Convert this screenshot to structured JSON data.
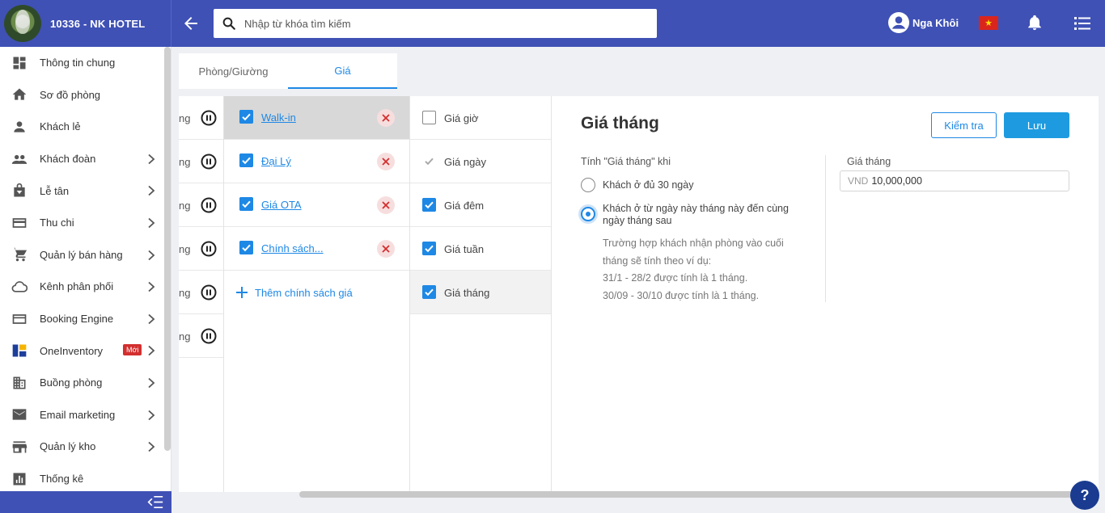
{
  "header": {
    "hotel_name": "10336 - NK HOTEL",
    "search_placeholder": "Nhập từ khóa tìm kiếm",
    "user_name": "Nga Khôi",
    "flag_star": "★"
  },
  "sidebar": {
    "items": [
      {
        "label": "Thông tin chung",
        "icon": "dashboard-icon"
      },
      {
        "label": "Sơ đồ phòng",
        "icon": "home-icon"
      },
      {
        "label": "Khách lẻ",
        "icon": "person-icon"
      },
      {
        "label": "Khách đoàn",
        "icon": "group-icon"
      },
      {
        "label": "Lễ tân",
        "icon": "bag-icon"
      },
      {
        "label": "Thu chi",
        "icon": "card-icon"
      },
      {
        "label": "Quản lý bán hàng",
        "icon": "cart-icon"
      },
      {
        "label": "Kênh phân phối",
        "icon": "cloud-icon"
      },
      {
        "label": "Booking Engine",
        "icon": "booking-icon"
      },
      {
        "label": "OneInventory",
        "icon": "inventory-icon"
      },
      {
        "label": "Buồng phòng",
        "icon": "building-icon"
      },
      {
        "label": "Email marketing",
        "icon": "email-icon"
      },
      {
        "label": "Quản lý kho",
        "icon": "store-icon"
      },
      {
        "label": "Thống kê",
        "icon": "chart-icon"
      }
    ],
    "new_badge": "Mới"
  },
  "tabs": [
    {
      "label": "Phòng/Giường",
      "active": false
    },
    {
      "label": "Giá",
      "active": true
    }
  ],
  "room_col_fragment": "ng",
  "policies": [
    {
      "label": "Walk-in",
      "selected": true
    },
    {
      "label": "Đại Lý",
      "selected": false
    },
    {
      "label": "Giá OTA",
      "selected": false
    },
    {
      "label": "Chính sách...",
      "selected": false
    }
  ],
  "add_policy_label": "Thêm chính sách giá",
  "price_types": [
    {
      "label": "Giá giờ",
      "state": "unchecked"
    },
    {
      "label": "Giá ngày",
      "state": "disabled-checked"
    },
    {
      "label": "Giá đêm",
      "state": "checked"
    },
    {
      "label": "Giá tuần",
      "state": "checked"
    },
    {
      "label": "Giá tháng",
      "state": "checked"
    }
  ],
  "detail": {
    "title": "Giá tháng",
    "check_button": "Kiểm tra",
    "save_button": "Lưu",
    "calc_label": "Tính \"Giá tháng\" khi",
    "option1": "Khách ở đủ 30 ngày",
    "option2": "Khách ở từ ngày này tháng này đến cùng ngày tháng sau",
    "note_lines": [
      "Trường hợp khách nhận phòng vào cuối",
      "tháng sẽ tính theo ví dụ:",
      "31/1 - 28/2 được tính là 1 tháng.",
      "30/09 - 30/10 được tính là 1 tháng."
    ],
    "monthly_label": "Giá tháng",
    "currency": "VND",
    "monthly_value": "10,000,000"
  },
  "help_label": "?",
  "colors": {
    "primary": "#3f51b5",
    "accent": "#1e88e5",
    "danger": "#d32f2f"
  }
}
